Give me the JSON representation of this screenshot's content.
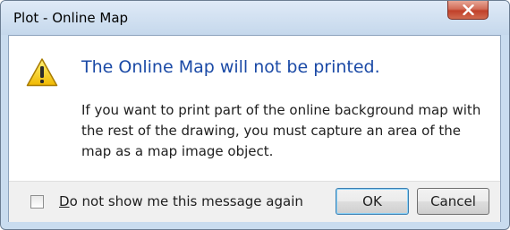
{
  "window": {
    "title": "Plot - Online Map",
    "close_icon": "close-x-icon"
  },
  "dialog": {
    "icon": "warning-triangle-icon",
    "main_instruction": "The Online Map will not be printed.",
    "body_text": "If you want to print part of the online background map with the rest of the drawing, you must capture an area of the map as a map image object."
  },
  "footer": {
    "checkbox_checked": false,
    "checkbox_label_mnemonic": "D",
    "checkbox_label_rest": "o not show me this message again",
    "ok_label": "OK",
    "cancel_label": "Cancel"
  },
  "colors": {
    "title_text": "#000000",
    "main_instruction": "#1b4aa6",
    "body_text": "#1e1e1e",
    "close_button": "#c1402a",
    "footer_background": "#f0f0f0",
    "window_frame": "#c9dcef"
  }
}
